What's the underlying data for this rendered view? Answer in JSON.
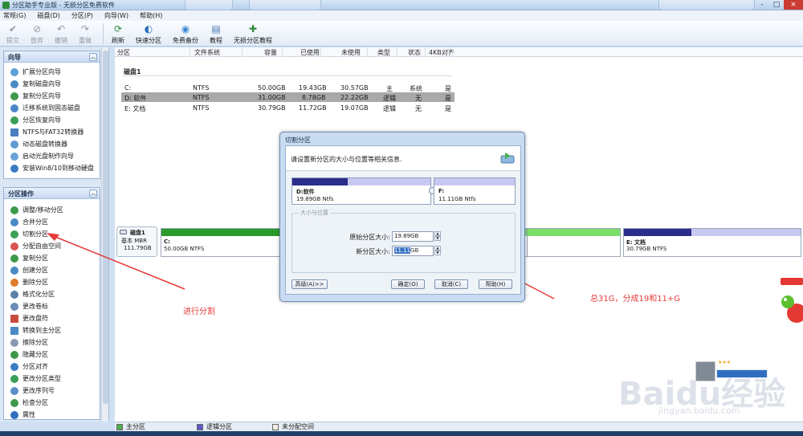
{
  "window": {
    "title": "分区助手专业版 - 无损分区免费软件",
    "controls": [
      "-",
      "□",
      "×"
    ]
  },
  "menu": [
    "常规(G)",
    "磁盘(D)",
    "分区(P)",
    "向导(W)",
    "帮助(H)"
  ],
  "toolbar": {
    "commit": "提交",
    "discard": "放弃",
    "undo": "撤销",
    "redo": "重做",
    "refresh": "刷新",
    "quick_partition": "快速分区",
    "free_backup": "免费备份",
    "tutorial": "教程",
    "lossless_tutorial": "无损分区教程"
  },
  "sidebar": {
    "wizard": {
      "title": "向导",
      "items": [
        "扩展分区向导",
        "复制磁盘向导",
        "复制分区向导",
        "迁移系统到固态磁盘",
        "分区恢复向导",
        "NTFS与FAT32转换器",
        "动态磁盘转换器",
        "启动光盘制作向导",
        "安装Win8/10到移动硬盘"
      ]
    },
    "ops": {
      "title": "分区操作",
      "items": [
        "调整/移动分区",
        "合并分区",
        "切割分区",
        "分配自由空间",
        "复制分区",
        "创建分区",
        "删除分区",
        "格式化分区",
        "更改卷标",
        "更改盘符",
        "转换到主分区",
        "擦除分区",
        "隐藏分区",
        "分区对齐",
        "更改分区类型",
        "更改序列号",
        "检查分区",
        "属性"
      ]
    }
  },
  "table": {
    "headers": [
      "分区",
      "文件系统",
      "容量",
      "已使用",
      "未使用",
      "类型",
      "状态",
      "4KB对齐"
    ],
    "disk_label": "磁盘1",
    "rows": [
      {
        "name": "C:",
        "fs": "NTFS",
        "cap": "50.00GB",
        "used": "19.43GB",
        "free": "30.57GB",
        "type": "主",
        "status": "系统",
        "align": "是"
      },
      {
        "name": "D: 软件",
        "fs": "NTFS",
        "cap": "31.00GB",
        "used": "8.78GB",
        "free": "22.22GB",
        "type": "逻辑",
        "status": "无",
        "align": "是"
      },
      {
        "name": "E: 文档",
        "fs": "NTFS",
        "cap": "30.79GB",
        "used": "11.72GB",
        "free": "19.07GB",
        "type": "逻辑",
        "status": "无",
        "align": "是"
      }
    ]
  },
  "diskmap": {
    "disk_name": "磁盘1",
    "disk_type": "基本 MBR",
    "disk_size": "111.79GB",
    "c_name": "C:",
    "c_size": "50.00GB NTFS",
    "e_name": "E: 文档",
    "e_size": "30.79GB NTFS",
    "c_used_fraction": 0.39,
    "e_used_fraction": 0.38
  },
  "legend": {
    "primary": "主分区",
    "logical": "逻辑分区",
    "unallocated": "未分配空间"
  },
  "dialog": {
    "title": "切割分区",
    "message": "请设置新分区的大小与位置等相关信息.",
    "left_name": "D:软件",
    "left_size": "19.89GB Ntfs",
    "right_name": "F:",
    "right_size": "11.11GB Ntfs",
    "group_label": "大小与位置",
    "orig_label": "原始分区大小:",
    "orig_value": "19.89GB",
    "new_label": "新分区大小:",
    "new_value_selected": "11.11",
    "new_value_unit": "GB",
    "advanced": "高级(A)>>",
    "ok": "确定(O)",
    "cancel": "取消(C)",
    "help": "帮助(H)"
  },
  "annotations": {
    "left": "进行分割",
    "right": "总31G，分成19和11+G"
  },
  "watermark": {
    "logo": "Baidu经验",
    "url": "jingyan.baidu.com"
  },
  "colors": {
    "primary": "#7be06a",
    "primary_dark": "#2a9a2a",
    "logical": "#c8c8f2",
    "logical_dark": "#2c2c8a",
    "selected_row": "#a9a9a9",
    "arrow": "#e53b3b"
  }
}
